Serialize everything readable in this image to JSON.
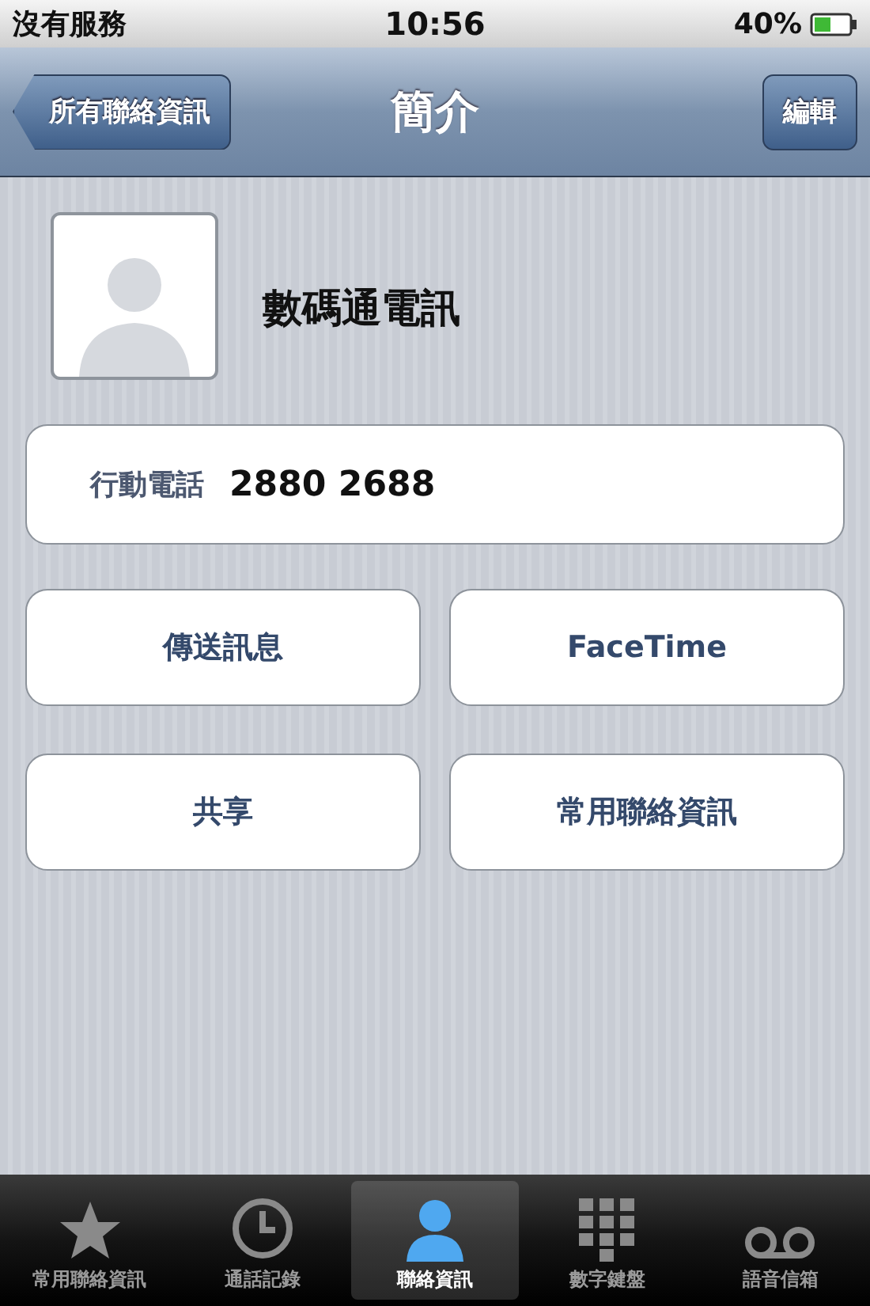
{
  "status_bar": {
    "carrier": "沒有服務",
    "time": "10:56",
    "battery": "40%"
  },
  "nav_bar": {
    "back": "所有聯絡資訊",
    "title": "簡介",
    "edit": "編輯"
  },
  "contact": {
    "name": "數碼通電訊"
  },
  "phone": {
    "label": "行動電話",
    "number": "2880 2688"
  },
  "actions": [
    "傳送訊息",
    "FaceTime",
    "共享",
    "常用聯絡資訊"
  ],
  "tabs": [
    {
      "label": "常用聯絡資訊",
      "kind": "star",
      "selected": false
    },
    {
      "label": "通話記錄",
      "kind": "clock",
      "selected": false
    },
    {
      "label": "聯絡資訊",
      "kind": "person",
      "selected": true
    },
    {
      "label": "數字鍵盤",
      "kind": "keypad",
      "selected": false
    },
    {
      "label": "語音信箱",
      "kind": "voicemail",
      "selected": false
    }
  ]
}
